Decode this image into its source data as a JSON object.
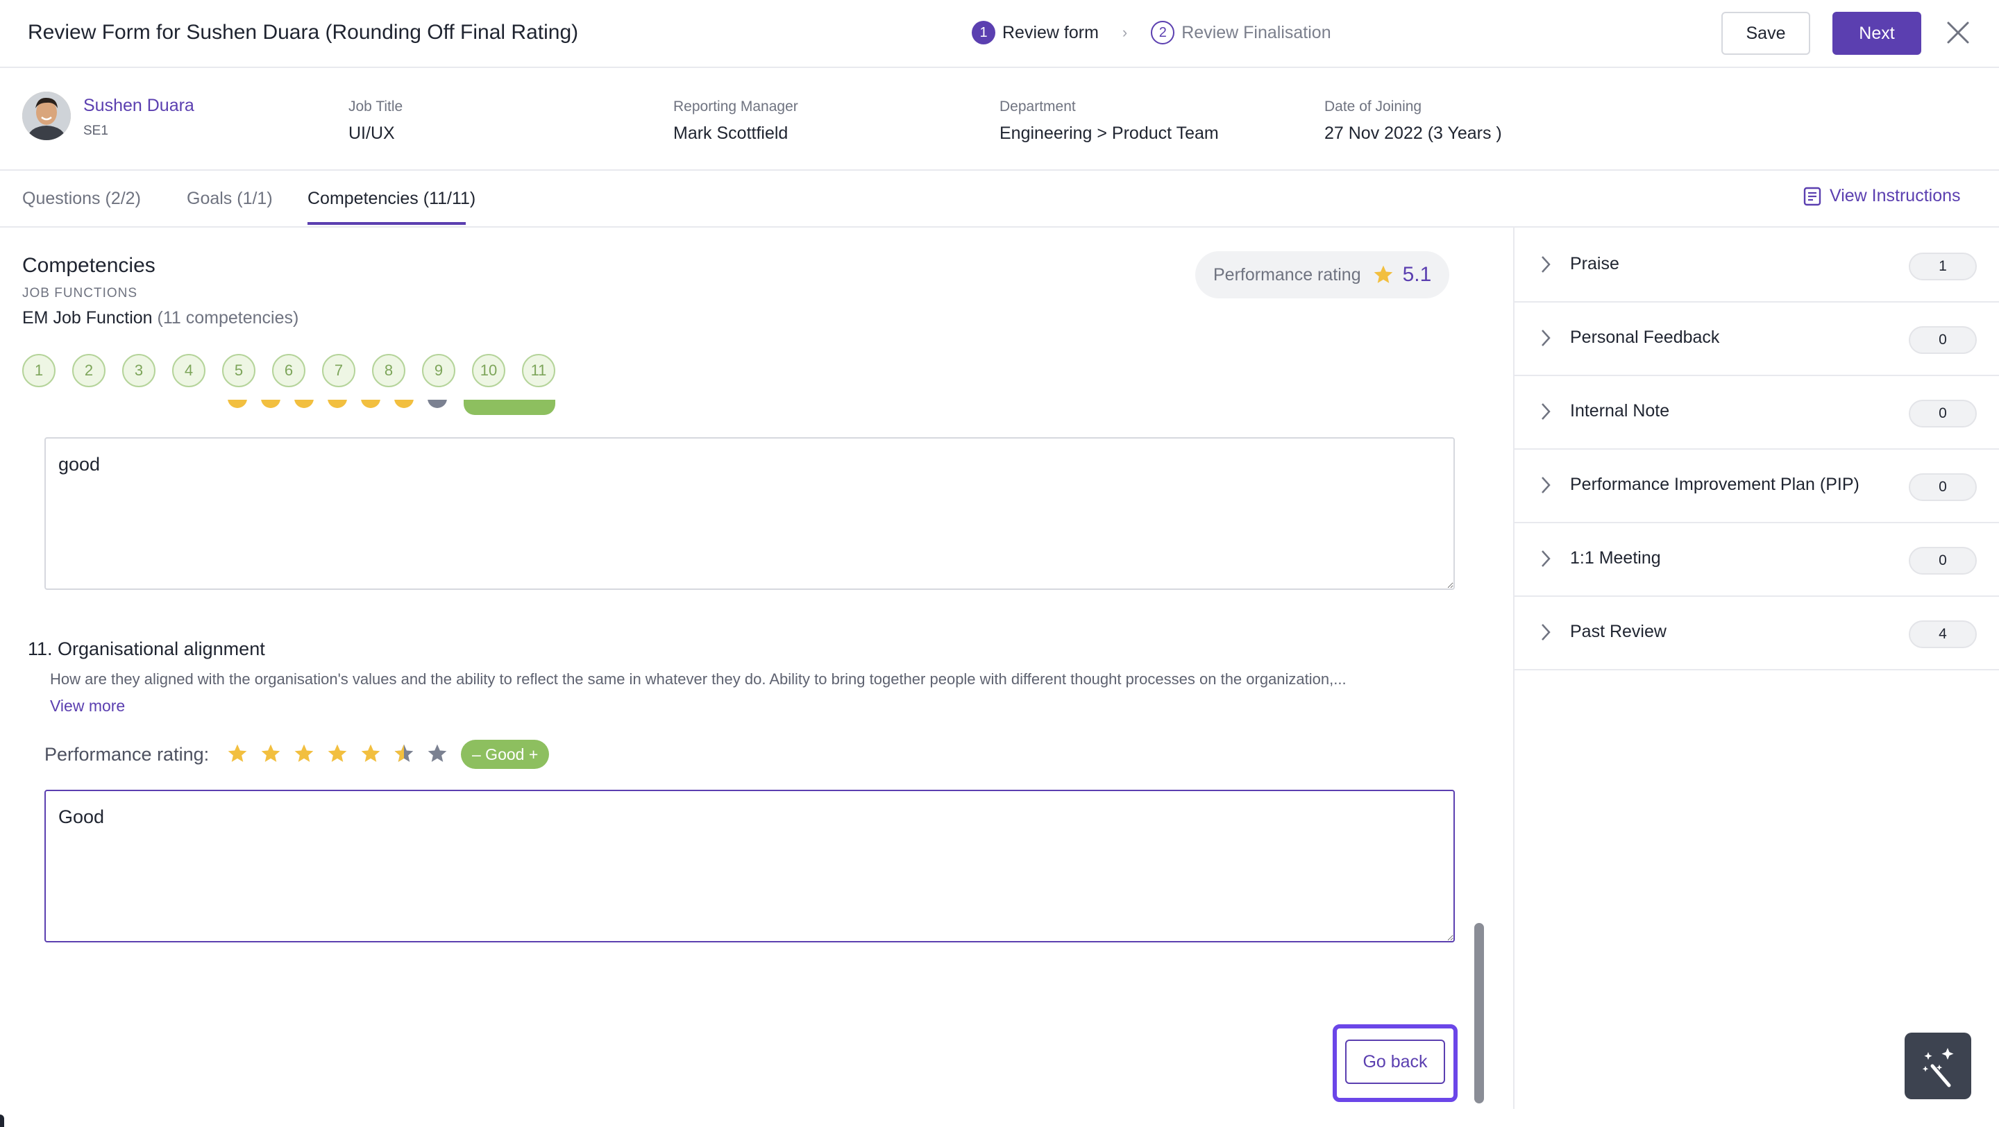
{
  "header": {
    "title": "Review Form for Sushen Duara (Rounding Off Final Rating)",
    "steps": [
      {
        "num": "1",
        "label": "Review form"
      },
      {
        "num": "2",
        "label": "Review Finalisation"
      }
    ],
    "save_label": "Save",
    "next_label": "Next"
  },
  "employee": {
    "name": "Sushen Duara",
    "level": "SE1",
    "fields": [
      {
        "label": "Job Title",
        "value": "UI/UX"
      },
      {
        "label": "Reporting Manager",
        "value": "Mark Scottfield"
      },
      {
        "label": "Department",
        "value": "Engineering > Product Team"
      },
      {
        "label": "Date of Joining",
        "value": "27 Nov 2022 (3 Years )"
      }
    ]
  },
  "tabs": [
    {
      "label": "Questions (2/2)"
    },
    {
      "label": "Goals (1/1)"
    },
    {
      "label": "Competencies (11/11)"
    }
  ],
  "view_instructions": "View Instructions",
  "competencies": {
    "title": "Competencies",
    "section_label": "JOB FUNCTIONS",
    "function_name": "EM Job Function",
    "function_count": "(11 competencies)",
    "performance_label": "Performance rating",
    "performance_score": "5.1",
    "chips": [
      "1",
      "2",
      "3",
      "4",
      "5",
      "6",
      "7",
      "8",
      "9",
      "10",
      "11"
    ]
  },
  "previous_answer": "good",
  "question": {
    "title": "11. Organisational alignment",
    "description": "How are they aligned with the organisation's values and the ability to reflect the same in whatever they do. Ability to bring together people with different thought processes on the organization,...",
    "view_more": "View more",
    "rating_label": "Performance rating:",
    "rating_value": 5.5,
    "rating_max": 7,
    "rating_badge": "– Good +",
    "answer": "Good"
  },
  "go_back_label": "Go back",
  "sidebar": {
    "items": [
      {
        "label": "Praise",
        "count": "1"
      },
      {
        "label": "Personal Feedback",
        "count": "0"
      },
      {
        "label": "Internal Note",
        "count": "0"
      },
      {
        "label": "Performance Improvement Plan (PIP)",
        "count": "0"
      },
      {
        "label": "1:1 Meeting",
        "count": "0"
      },
      {
        "label": "Past Review",
        "count": "4"
      }
    ]
  },
  "colors": {
    "accent": "#5b3fb0",
    "star": "#f2bf3f",
    "star_empty": "#7b8191",
    "good_badge": "#8dbf5f",
    "highlight": "#6b46e8"
  }
}
